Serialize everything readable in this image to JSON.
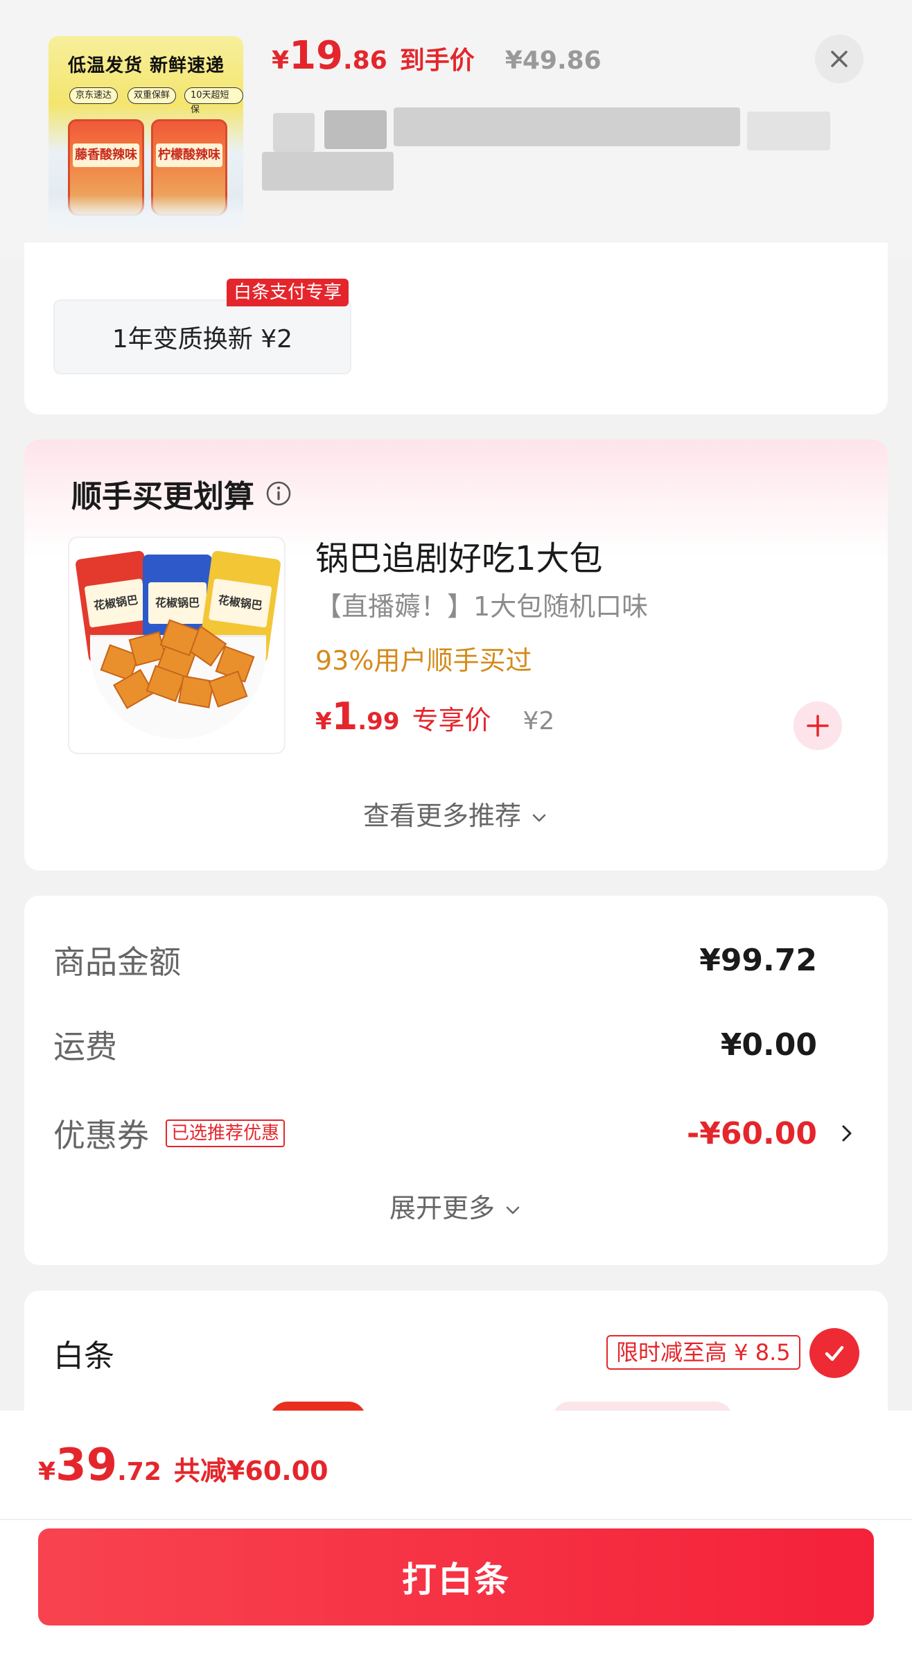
{
  "header": {
    "price_currency": "¥",
    "price_int": "19",
    "price_dec": ".86",
    "price_tag": "到手价",
    "original_price": "¥49.86",
    "thumb_headline": "低温发货  新鲜速递",
    "thumb_chips": [
      "京东速达",
      "双重保鲜",
      "10天超短保"
    ],
    "thumb_jar_labels": [
      "藤香酸辣味",
      "柠檬酸辣味"
    ]
  },
  "warranty": {
    "badge": "白条支付专享",
    "option": "1年变质换新  ¥2"
  },
  "addon": {
    "section_title": "顺手买更划算",
    "product_name": "锅巴追剧好吃1大包",
    "product_sub": "【直播薅！】1大包随机口味",
    "bought_rate": "93%用户顺手买过",
    "price_currency": "¥",
    "price_int": "1",
    "price_dec": ".99",
    "price_tag": "专享价",
    "orig_price": "¥2",
    "bag_label": "花椒锅巴",
    "more_label": "查看更多推荐"
  },
  "summary": {
    "goods_label": "商品金额",
    "goods_value": "¥99.72",
    "shipping_label": "运费",
    "shipping_value": "¥0.00",
    "coupon_label": "优惠券",
    "coupon_badge": "已选推荐优惠",
    "coupon_value": "-¥60.00",
    "expand_label": "展开更多"
  },
  "payment": {
    "method": "白条",
    "limit_badge": "限时减至高 ¥ 8.5",
    "selected": true
  },
  "footer": {
    "total_currency": "¥",
    "total_int": "39",
    "total_dec": ".72",
    "total_saved": "共减¥60.00",
    "pay_button": "打白条"
  },
  "colors": {
    "accent": "#e4262c",
    "button_gradient_start": "#f8434f",
    "button_gradient_end": "#f4213a",
    "bought_text": "#d48a1a"
  }
}
